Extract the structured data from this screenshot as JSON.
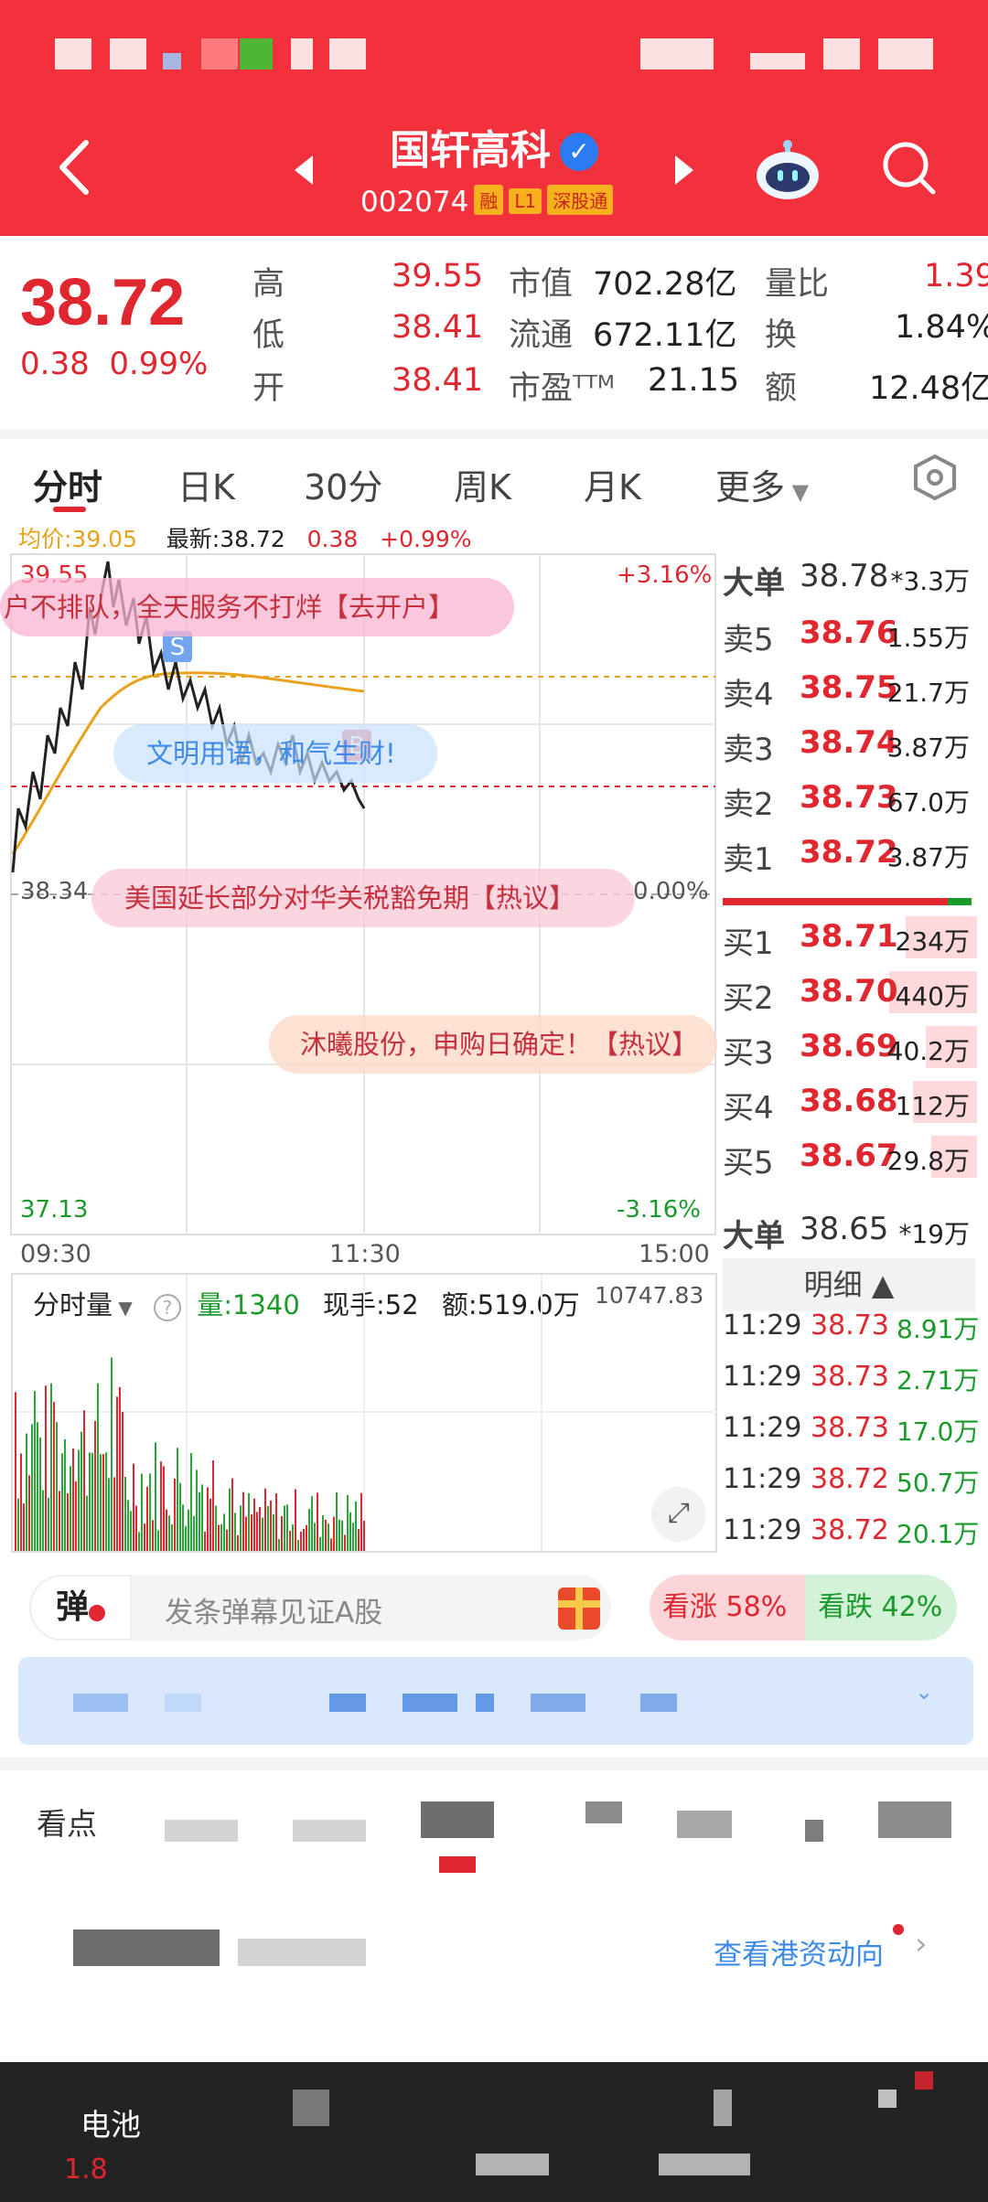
{
  "header": {
    "stock_name": "国轩高科",
    "verify_mark": "✓",
    "stock_code": "002074",
    "tags": [
      "融",
      "L1",
      "深股通"
    ]
  },
  "quote": {
    "price": "38.72",
    "change": "0.38",
    "change_pct": "0.99%",
    "high_label": "高",
    "high": "39.55",
    "low_label": "低",
    "low": "38.41",
    "open_label": "开",
    "open": "38.41",
    "mcap_label": "市值",
    "mcap": "702.28亿",
    "float_label": "流通",
    "float": "672.11亿",
    "pe_label": "市盈ᵀᵀᴹ",
    "pe": "21.15",
    "ratio_label": "量比",
    "ratio": "1.39",
    "turnover_label": "换",
    "turnover": "1.84%",
    "amount_label": "额",
    "amount": "12.48亿"
  },
  "tabs": [
    "分时",
    "日K",
    "30分",
    "周K",
    "月K",
    "更多"
  ],
  "chart_info": {
    "avg_label": "均价:39.05",
    "latest_label": "最新:38.72",
    "change": "0.38",
    "change_pct": "+0.99%",
    "top_price": "39.55",
    "top_pct": "+3.16%",
    "base_price": "38.34",
    "base_pct": "0.00%",
    "bottom_price": "37.13",
    "bottom_pct": "-3.16%",
    "time_start": "09:30",
    "time_mid": "11:30",
    "time_end": "15:00",
    "marker_s": "S",
    "marker_b": "B"
  },
  "bubbles": [
    "户不排队，全天服务不打烊【去开户】",
    "文明用语，和气生财!",
    "美国延长部分对华关税豁免期【热议】",
    "沐曦股份，申购日确定！【热议】"
  ],
  "volume_info": {
    "selector": "分时量",
    "vol": "量:1340",
    "hand": "现手:52",
    "amount": "额:519.0万",
    "max": "10747.83"
  },
  "order_book": {
    "big_sell_label": "大单",
    "big_sell_price": "38.78",
    "big_sell_vol": "*3.3万",
    "asks": [
      {
        "label": "卖5",
        "price": "38.76",
        "vol": "1.55万"
      },
      {
        "label": "卖4",
        "price": "38.75",
        "vol": "21.7万"
      },
      {
        "label": "卖3",
        "price": "38.74",
        "vol": "3.87万"
      },
      {
        "label": "卖2",
        "price": "38.73",
        "vol": "67.0万"
      },
      {
        "label": "卖1",
        "price": "38.72",
        "vol": "3.87万"
      }
    ],
    "bids": [
      {
        "label": "买1",
        "price": "38.71",
        "vol": "234万"
      },
      {
        "label": "买2",
        "price": "38.70",
        "vol": "440万"
      },
      {
        "label": "买3",
        "price": "38.69",
        "vol": "40.2万"
      },
      {
        "label": "买4",
        "price": "38.68",
        "vol": "112万"
      },
      {
        "label": "买5",
        "price": "38.67",
        "vol": "29.8万"
      }
    ],
    "big_buy_label": "大单",
    "big_buy_price": "38.65",
    "big_buy_vol": "*19万",
    "detail_label": "明细 ▲"
  },
  "ticks": [
    {
      "time": "11:29",
      "price": "38.73",
      "vol": "8.91万"
    },
    {
      "time": "11:29",
      "price": "38.73",
      "vol": "2.71万"
    },
    {
      "time": "11:29",
      "price": "38.73",
      "vol": "17.0万"
    },
    {
      "time": "11:29",
      "price": "38.72",
      "vol": "50.7万"
    },
    {
      "time": "11:29",
      "price": "38.72",
      "vol": "20.1万"
    }
  ],
  "danmu": {
    "badge": "弹",
    "placeholder": "发条弹幕见证A股",
    "up": "看涨 58%",
    "down": "看跌 42%"
  },
  "section": {
    "label": "看点",
    "link": "查看港资动向"
  },
  "bottom": {
    "left_label": "电池",
    "left_value": "1.8"
  },
  "colors": {
    "brand": "#f2313d",
    "up": "#e0262f",
    "down": "#1a9a2a",
    "avg_line": "#e8a21c"
  },
  "icons": [
    "back-arrow-icon",
    "prev-triangle-icon",
    "next-triangle-icon",
    "robot-icon",
    "search-icon",
    "settings-hexagon-icon",
    "help-icon",
    "expand-icon",
    "gift-icon",
    "chevron-down-icon",
    "chevron-right-icon"
  ]
}
